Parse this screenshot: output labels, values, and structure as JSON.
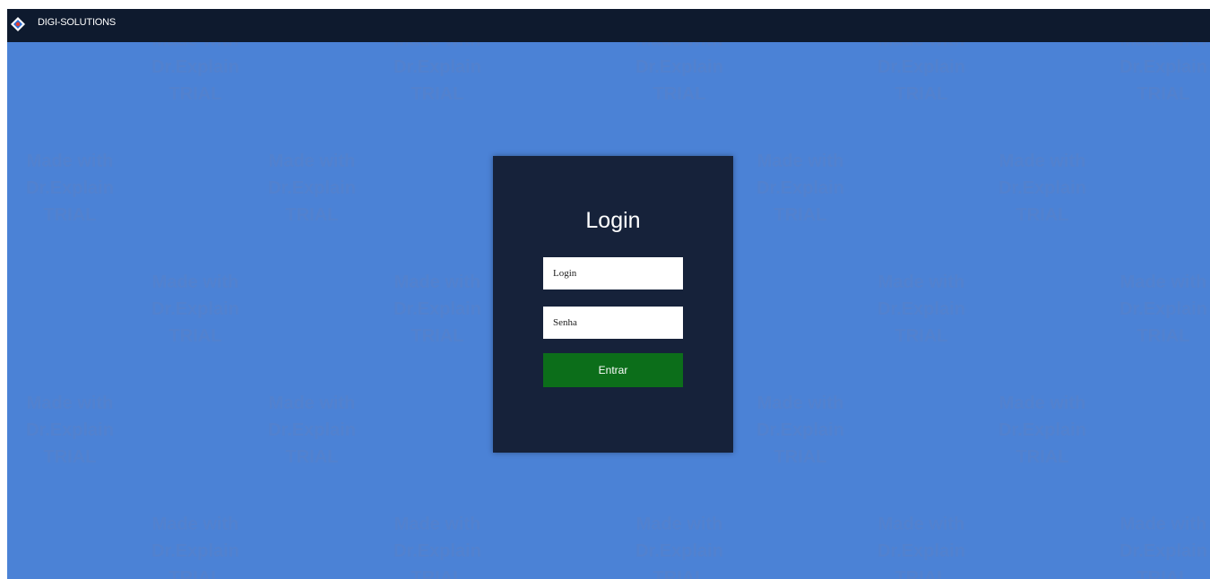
{
  "header": {
    "brand": "DIGI-SOLUTIONS",
    "logo_icon": "diamond-logo-icon",
    "background_color": "#0e1a2e"
  },
  "page": {
    "background_color": "#4b82d6",
    "watermark_text": [
      "Made with",
      "Dr.Explain",
      "TRIAL"
    ]
  },
  "login": {
    "title": "Login",
    "username_placeholder": "Login",
    "password_placeholder": "Senha",
    "submit_label": "Entrar",
    "card_color": "#16223a",
    "submit_color": "#0c6e1a"
  }
}
